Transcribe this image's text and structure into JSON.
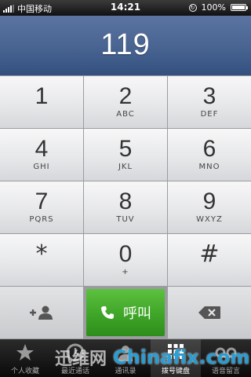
{
  "status": {
    "carrier": "中国移动",
    "time": "14:21",
    "battery": "100%"
  },
  "display": {
    "number": "119"
  },
  "keys": [
    {
      "digit": "1",
      "letters": ""
    },
    {
      "digit": "2",
      "letters": "ABC"
    },
    {
      "digit": "3",
      "letters": "DEF"
    },
    {
      "digit": "4",
      "letters": "GHI"
    },
    {
      "digit": "5",
      "letters": "JKL"
    },
    {
      "digit": "6",
      "letters": "MNO"
    },
    {
      "digit": "7",
      "letters": "PQRS"
    },
    {
      "digit": "8",
      "letters": "TUV"
    },
    {
      "digit": "9",
      "letters": "WXYZ"
    },
    {
      "digit": "*",
      "letters": ""
    },
    {
      "digit": "0",
      "letters": "+"
    },
    {
      "digit": "#",
      "letters": ""
    }
  ],
  "actions": {
    "call_label": "呼叫"
  },
  "tabs": [
    {
      "label": "个人收藏",
      "icon": "star-icon"
    },
    {
      "label": "最近通话",
      "icon": "clock-icon"
    },
    {
      "label": "通讯录",
      "icon": "contacts-icon"
    },
    {
      "label": "拨号键盘",
      "icon": "keypad-icon",
      "active": true
    },
    {
      "label": "语音留言",
      "icon": "voicemail-icon"
    }
  ],
  "watermark": {
    "part1": "迅维网",
    "part2": "Chinafix.com"
  },
  "colors": {
    "call": "#3fa528",
    "display": "#4a6592"
  }
}
